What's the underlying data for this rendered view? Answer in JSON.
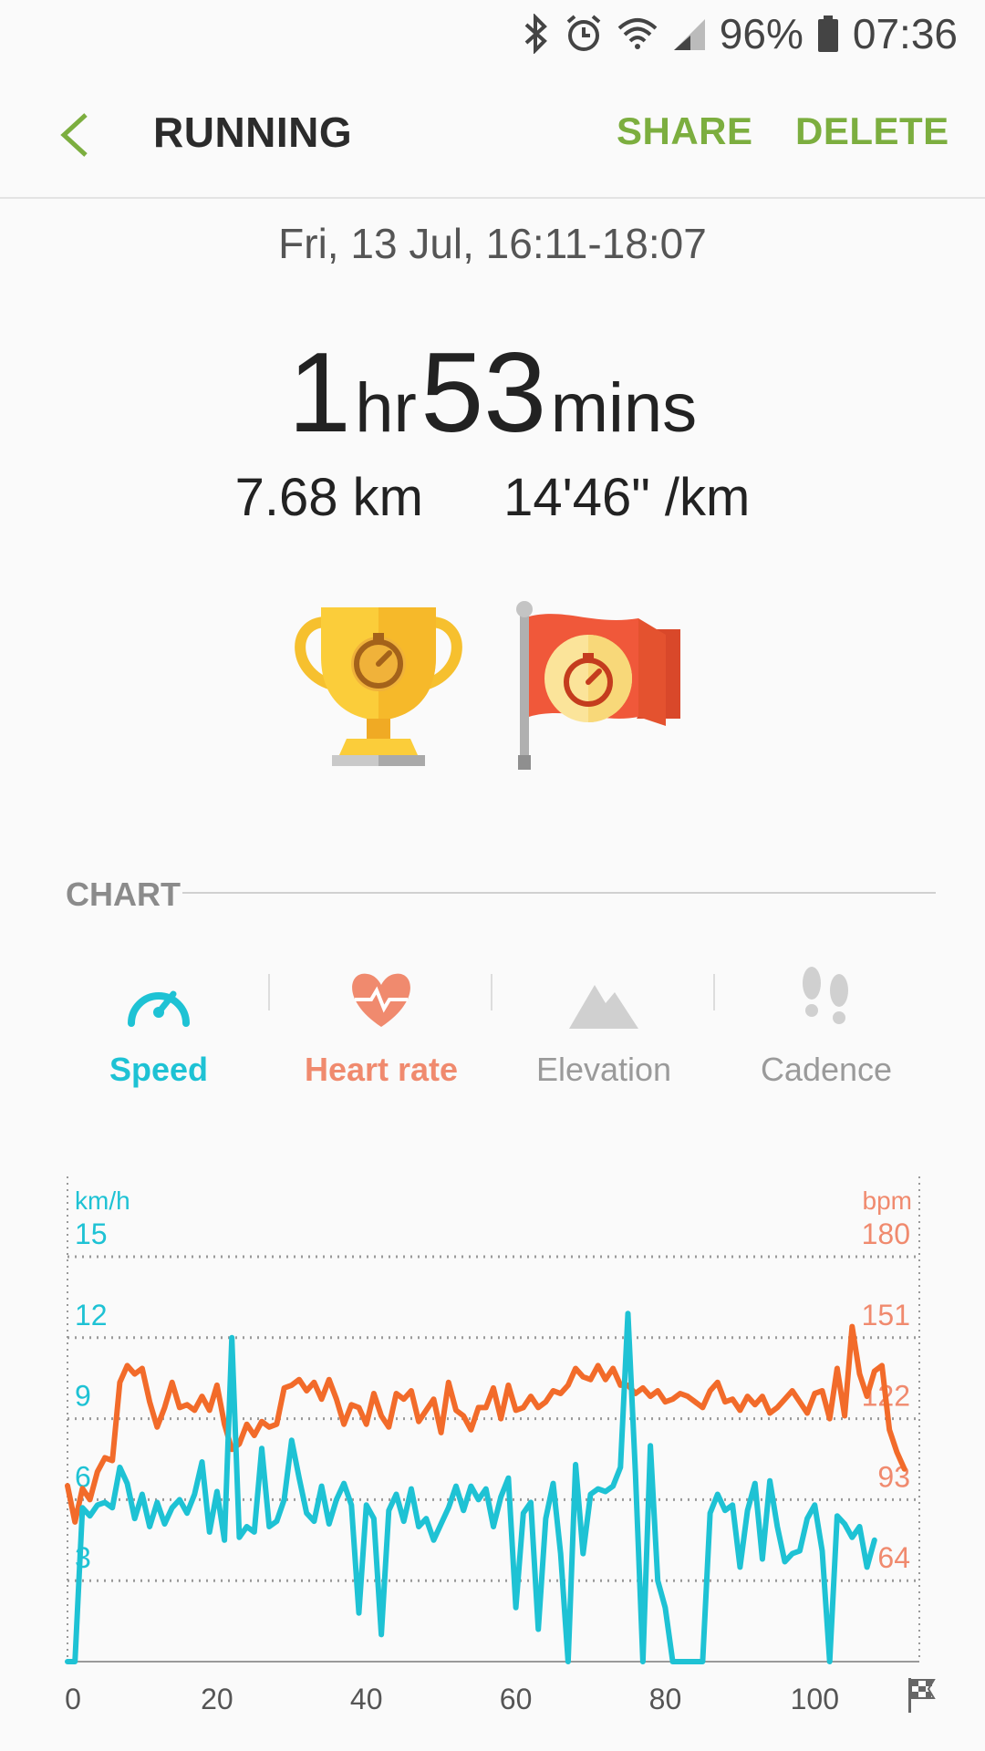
{
  "status_bar": {
    "battery": "96%",
    "time": "07:36"
  },
  "app_bar": {
    "title": "RUNNING",
    "share_label": "SHARE",
    "delete_label": "DELETE"
  },
  "workout": {
    "date_range": "Fri, 13 Jul, 16:11-18:07",
    "duration_hours": "1",
    "hours_unit": "hr",
    "duration_minutes": "53",
    "minutes_unit": "mins",
    "distance": "7.68 km",
    "pace": "14'46\" /km"
  },
  "chart_section": {
    "label": "CHART",
    "tabs": [
      {
        "label": "Speed",
        "icon": "speedometer-icon",
        "color": "#1ec2d4"
      },
      {
        "label": "Heart rate",
        "icon": "heart-icon",
        "color": "#f08a6e"
      },
      {
        "label": "Elevation",
        "icon": "mountain-icon",
        "color": "#9a9a9a"
      },
      {
        "label": "Cadence",
        "icon": "footsteps-icon",
        "color": "#9a9a9a"
      }
    ]
  },
  "chart_data": {
    "type": "line",
    "x_unit_note": "minutes",
    "xlim": [
      0,
      114
    ],
    "x_ticks": [
      "0",
      "20",
      "40",
      "60",
      "80",
      "100"
    ],
    "left_axis": {
      "unit": "km/h",
      "ticks": [
        "15",
        "12",
        "9",
        "6",
        "3"
      ],
      "ylim": [
        0,
        15
      ],
      "color": "#1ec2d4"
    },
    "right_axis": {
      "unit": "bpm",
      "ticks": [
        "180",
        "151",
        "122",
        "93",
        "64"
      ],
      "ylim": [
        35,
        180
      ],
      "color": "#f08a6e"
    },
    "series": [
      {
        "axis": "left",
        "color": "#1ec2d4",
        "points": [
          [
            0,
            0
          ],
          [
            1,
            0
          ],
          [
            2,
            5.7
          ],
          [
            3,
            5.4
          ],
          [
            4,
            5.8
          ],
          [
            5,
            5.9
          ],
          [
            6,
            5.7
          ],
          [
            7,
            7.2
          ],
          [
            8,
            6.6
          ],
          [
            9,
            5.3
          ],
          [
            10,
            6.2
          ],
          [
            11,
            5.0
          ],
          [
            12,
            5.9
          ],
          [
            13,
            5.1
          ],
          [
            14,
            5.7
          ],
          [
            15,
            6.0
          ],
          [
            16,
            5.5
          ],
          [
            17,
            6.2
          ],
          [
            18,
            7.4
          ],
          [
            19,
            4.8
          ],
          [
            20,
            6.3
          ],
          [
            21,
            4.5
          ],
          [
            22,
            12.0
          ],
          [
            23,
            4.6
          ],
          [
            24,
            5.0
          ],
          [
            25,
            4.8
          ],
          [
            26,
            7.9
          ],
          [
            27,
            5.0
          ],
          [
            28,
            5.2
          ],
          [
            29,
            6.0
          ],
          [
            30,
            8.2
          ],
          [
            31,
            6.8
          ],
          [
            32,
            5.5
          ],
          [
            33,
            5.2
          ],
          [
            34,
            6.5
          ],
          [
            35,
            5.1
          ],
          [
            36,
            6.0
          ],
          [
            37,
            6.6
          ],
          [
            38,
            5.8
          ],
          [
            39,
            1.8
          ],
          [
            40,
            5.8
          ],
          [
            41,
            5.3
          ],
          [
            42,
            1.0
          ],
          [
            43,
            5.6
          ],
          [
            44,
            6.2
          ],
          [
            45,
            5.2
          ],
          [
            46,
            6.4
          ],
          [
            47,
            5.0
          ],
          [
            48,
            5.3
          ],
          [
            49,
            4.5
          ],
          [
            50,
            5.1
          ],
          [
            51,
            5.7
          ],
          [
            52,
            6.5
          ],
          [
            53,
            5.6
          ],
          [
            54,
            6.5
          ],
          [
            55,
            6.0
          ],
          [
            56,
            6.4
          ],
          [
            57,
            5.0
          ],
          [
            58,
            6.1
          ],
          [
            59,
            6.8
          ],
          [
            60,
            2.0
          ],
          [
            61,
            5.5
          ],
          [
            62,
            5.9
          ],
          [
            63,
            1.2
          ],
          [
            64,
            5.3
          ],
          [
            65,
            6.6
          ],
          [
            66,
            4.0
          ],
          [
            67,
            0
          ],
          [
            68,
            7.3
          ],
          [
            69,
            4.0
          ],
          [
            70,
            6.2
          ],
          [
            71,
            6.4
          ],
          [
            72,
            6.3
          ],
          [
            73,
            6.5
          ],
          [
            74,
            7.2
          ],
          [
            75,
            12.9
          ],
          [
            76,
            7.0
          ],
          [
            77,
            0
          ],
          [
            78,
            8.0
          ],
          [
            79,
            3.0
          ],
          [
            80,
            2.0
          ],
          [
            81,
            0
          ],
          [
            82,
            0
          ],
          [
            83,
            0
          ],
          [
            84,
            0
          ],
          [
            85,
            0
          ],
          [
            86,
            5.5
          ],
          [
            87,
            6.2
          ],
          [
            88,
            5.6
          ],
          [
            89,
            5.8
          ],
          [
            90,
            3.5
          ],
          [
            91,
            5.6
          ],
          [
            92,
            6.6
          ],
          [
            93,
            3.8
          ],
          [
            94,
            6.7
          ],
          [
            95,
            5.0
          ],
          [
            96,
            3.7
          ],
          [
            97,
            4.0
          ],
          [
            98,
            4.1
          ],
          [
            99,
            5.3
          ],
          [
            100,
            5.8
          ],
          [
            101,
            4.1
          ],
          [
            102,
            0
          ],
          [
            103,
            5.4
          ],
          [
            104,
            5.1
          ],
          [
            105,
            4.6
          ],
          [
            106,
            5.0
          ],
          [
            107,
            3.5
          ],
          [
            108,
            4.5
          ]
        ]
      },
      {
        "axis": "right",
        "color": "#f26b2a",
        "points": [
          [
            0,
            98
          ],
          [
            1,
            85
          ],
          [
            2,
            97
          ],
          [
            3,
            93
          ],
          [
            4,
            103
          ],
          [
            5,
            108
          ],
          [
            6,
            107
          ],
          [
            7,
            135
          ],
          [
            8,
            141
          ],
          [
            9,
            138
          ],
          [
            10,
            140
          ],
          [
            11,
            128
          ],
          [
            12,
            119
          ],
          [
            13,
            126
          ],
          [
            14,
            135
          ],
          [
            15,
            126
          ],
          [
            16,
            127
          ],
          [
            17,
            125
          ],
          [
            18,
            130
          ],
          [
            19,
            125
          ],
          [
            20,
            134
          ],
          [
            21,
            120
          ],
          [
            22,
            111
          ],
          [
            23,
            113
          ],
          [
            24,
            120
          ],
          [
            25,
            116
          ],
          [
            26,
            121
          ],
          [
            27,
            119
          ],
          [
            28,
            120
          ],
          [
            29,
            133
          ],
          [
            30,
            134
          ],
          [
            31,
            136
          ],
          [
            32,
            132
          ],
          [
            33,
            135
          ],
          [
            34,
            129
          ],
          [
            35,
            136
          ],
          [
            36,
            129
          ],
          [
            37,
            120
          ],
          [
            38,
            127
          ],
          [
            39,
            126
          ],
          [
            40,
            120
          ],
          [
            41,
            131
          ],
          [
            42,
            123
          ],
          [
            43,
            119
          ],
          [
            44,
            131
          ],
          [
            45,
            129
          ],
          [
            46,
            132
          ],
          [
            47,
            121
          ],
          [
            48,
            125
          ],
          [
            49,
            129
          ],
          [
            50,
            117
          ],
          [
            51,
            135
          ],
          [
            52,
            125
          ],
          [
            53,
            123
          ],
          [
            54,
            118
          ],
          [
            55,
            126
          ],
          [
            56,
            126
          ],
          [
            57,
            133
          ],
          [
            58,
            122
          ],
          [
            59,
            134
          ],
          [
            60,
            125
          ],
          [
            61,
            126
          ],
          [
            62,
            130
          ],
          [
            63,
            126
          ],
          [
            64,
            128
          ],
          [
            65,
            132
          ],
          [
            66,
            131
          ],
          [
            67,
            134
          ],
          [
            68,
            140
          ],
          [
            69,
            137
          ],
          [
            70,
            136
          ],
          [
            71,
            141
          ],
          [
            72,
            136
          ],
          [
            73,
            140
          ],
          [
            74,
            134
          ],
          [
            75,
            134
          ],
          [
            76,
            131
          ],
          [
            77,
            133
          ],
          [
            78,
            130
          ],
          [
            79,
            132
          ],
          [
            80,
            128
          ],
          [
            81,
            129
          ],
          [
            82,
            131
          ],
          [
            83,
            130
          ],
          [
            84,
            128
          ],
          [
            85,
            126
          ],
          [
            86,
            132
          ],
          [
            87,
            135
          ],
          [
            88,
            128
          ],
          [
            89,
            129
          ],
          [
            90,
            125
          ],
          [
            91,
            130
          ],
          [
            92,
            127
          ],
          [
            93,
            130
          ],
          [
            94,
            124
          ],
          [
            95,
            126
          ],
          [
            96,
            129
          ],
          [
            97,
            132
          ],
          [
            98,
            128
          ],
          [
            99,
            124
          ],
          [
            100,
            131
          ],
          [
            101,
            132
          ],
          [
            102,
            122
          ],
          [
            103,
            140
          ],
          [
            104,
            123
          ],
          [
            105,
            155
          ],
          [
            106,
            138
          ],
          [
            107,
            130
          ],
          [
            108,
            139
          ],
          [
            109,
            141
          ],
          [
            110,
            118
          ],
          [
            111,
            110
          ],
          [
            112,
            104
          ]
        ]
      }
    ]
  }
}
